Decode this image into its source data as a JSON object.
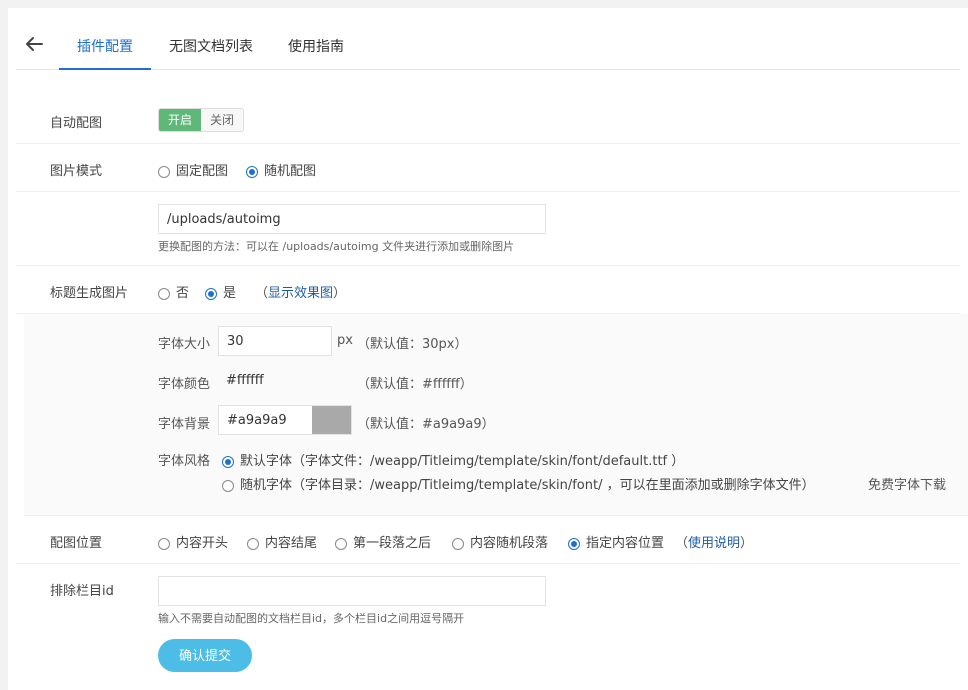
{
  "tabs": [
    "插件配置",
    "无图文档列表",
    "使用指南"
  ],
  "auto_img": {
    "label": "自动配图",
    "on_label": "开启",
    "off_label": "关闭",
    "value": "on"
  },
  "img_mode": {
    "label": "图片模式",
    "options": [
      "固定配图",
      "随机配图"
    ],
    "selected": 1
  },
  "folder": {
    "value": "/uploads/autoimg",
    "hint": "更换配图的方法：可以在 /uploads/autoimg 文件夹进行添加或删除图片"
  },
  "title_img": {
    "label": "标题生成图片",
    "options": [
      "否",
      "是"
    ],
    "selected": 1,
    "preview_open": "（",
    "preview_link": "显示效果图",
    "preview_close": "）"
  },
  "font_size": {
    "label": "字体大小",
    "value": "30",
    "unit": "px",
    "default": "（默认值：30px）"
  },
  "font_color": {
    "label": "字体颜色",
    "value": "#ffffff",
    "default": "（默认值：#ffffff）"
  },
  "font_bg": {
    "label": "字体背景",
    "value": "#a9a9a9",
    "default": "（默认值：#a9a9a9）",
    "swatch": "#a9a9a9"
  },
  "font_style": {
    "label": "字体风格",
    "options": [
      "默认字体（字体文件：/weapp/Titleimg/template/skin/font/default.ttf ）",
      "随机字体（字体目录：/weapp/Titleimg/template/skin/font/ ，可以在里面添加或删除字体文件）"
    ],
    "selected": 0,
    "download_link": "免费字体下载"
  },
  "position": {
    "label": "配图位置",
    "options": [
      "内容开头",
      "内容结尾",
      "第一段落之后",
      "内容随机段落",
      "指定内容位置"
    ],
    "selected": 4,
    "help_open": "（",
    "help_link": "使用说明",
    "help_close": "）"
  },
  "exclude": {
    "label": "排除栏目id",
    "value": "",
    "hint": "输入不需要自动配图的文档栏目id，多个栏目id之间用逗号隔开"
  },
  "submit_label": "确认提交",
  "colors": {
    "accent": "#1e6fd0",
    "toggle_on": "#5fb878",
    "submit": "#4bbde6"
  }
}
